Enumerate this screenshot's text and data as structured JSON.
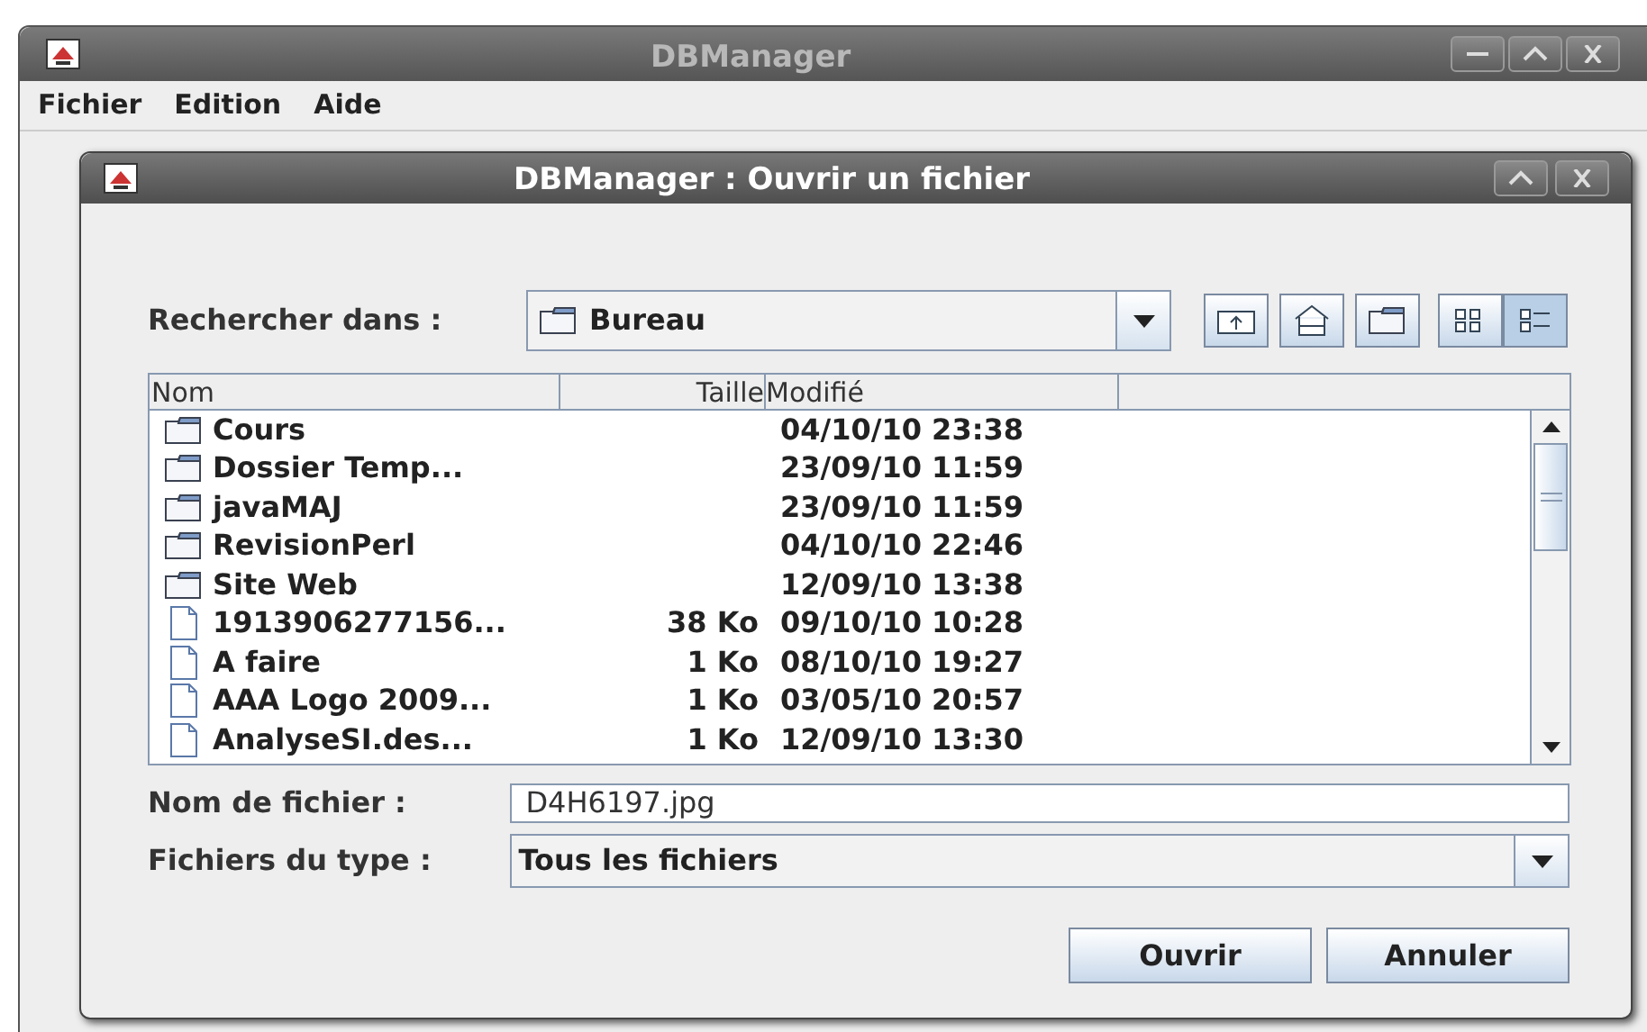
{
  "window": {
    "title": "DBManager"
  },
  "menu": [
    "Fichier",
    "Edition",
    "Aide"
  ],
  "dialog": {
    "title": "DBManager : Ouvrir un fichier",
    "look_in": {
      "label": "Rechercher dans :",
      "value": "Bureau"
    },
    "view_buttons": [
      {
        "kind": "list",
        "selected": false
      },
      {
        "kind": "details",
        "selected": true
      }
    ],
    "columns": [
      "Nom",
      "Taille",
      "Modifié"
    ],
    "rows": [
      {
        "kind": "folder",
        "name": "Cours",
        "size": "",
        "modified": "04/10/10 23:38"
      },
      {
        "kind": "folder",
        "name": "Dossier Temp...",
        "size": "",
        "modified": "23/09/10 11:59"
      },
      {
        "kind": "folder",
        "name": "javaMAJ",
        "size": "",
        "modified": "23/09/10 11:59"
      },
      {
        "kind": "folder",
        "name": "RevisionPerl",
        "size": "",
        "modified": "04/10/10 22:46"
      },
      {
        "kind": "folder",
        "name": "Site Web",
        "size": "",
        "modified": "12/09/10 13:38"
      },
      {
        "kind": "file",
        "name": "1913906277156...",
        "size": "38 Ko",
        "modified": "09/10/10 10:28"
      },
      {
        "kind": "file",
        "name": "A faire",
        "size": "1 Ko",
        "modified": "08/10/10 19:27"
      },
      {
        "kind": "file",
        "name": "AAA Logo 2009...",
        "size": "1 Ko",
        "modified": "03/05/10 20:57"
      },
      {
        "kind": "file",
        "name": "AnalyseSI.des...",
        "size": "1 Ko",
        "modified": "12/09/10 13:30"
      }
    ],
    "file_name": {
      "label": "Nom de fichier :",
      "value": "D4H6197.jpg"
    },
    "file_type": {
      "label": "Fichiers du type :",
      "value": "Tous les fichiers"
    },
    "buttons": [
      "Ouvrir",
      "Annuler"
    ]
  }
}
